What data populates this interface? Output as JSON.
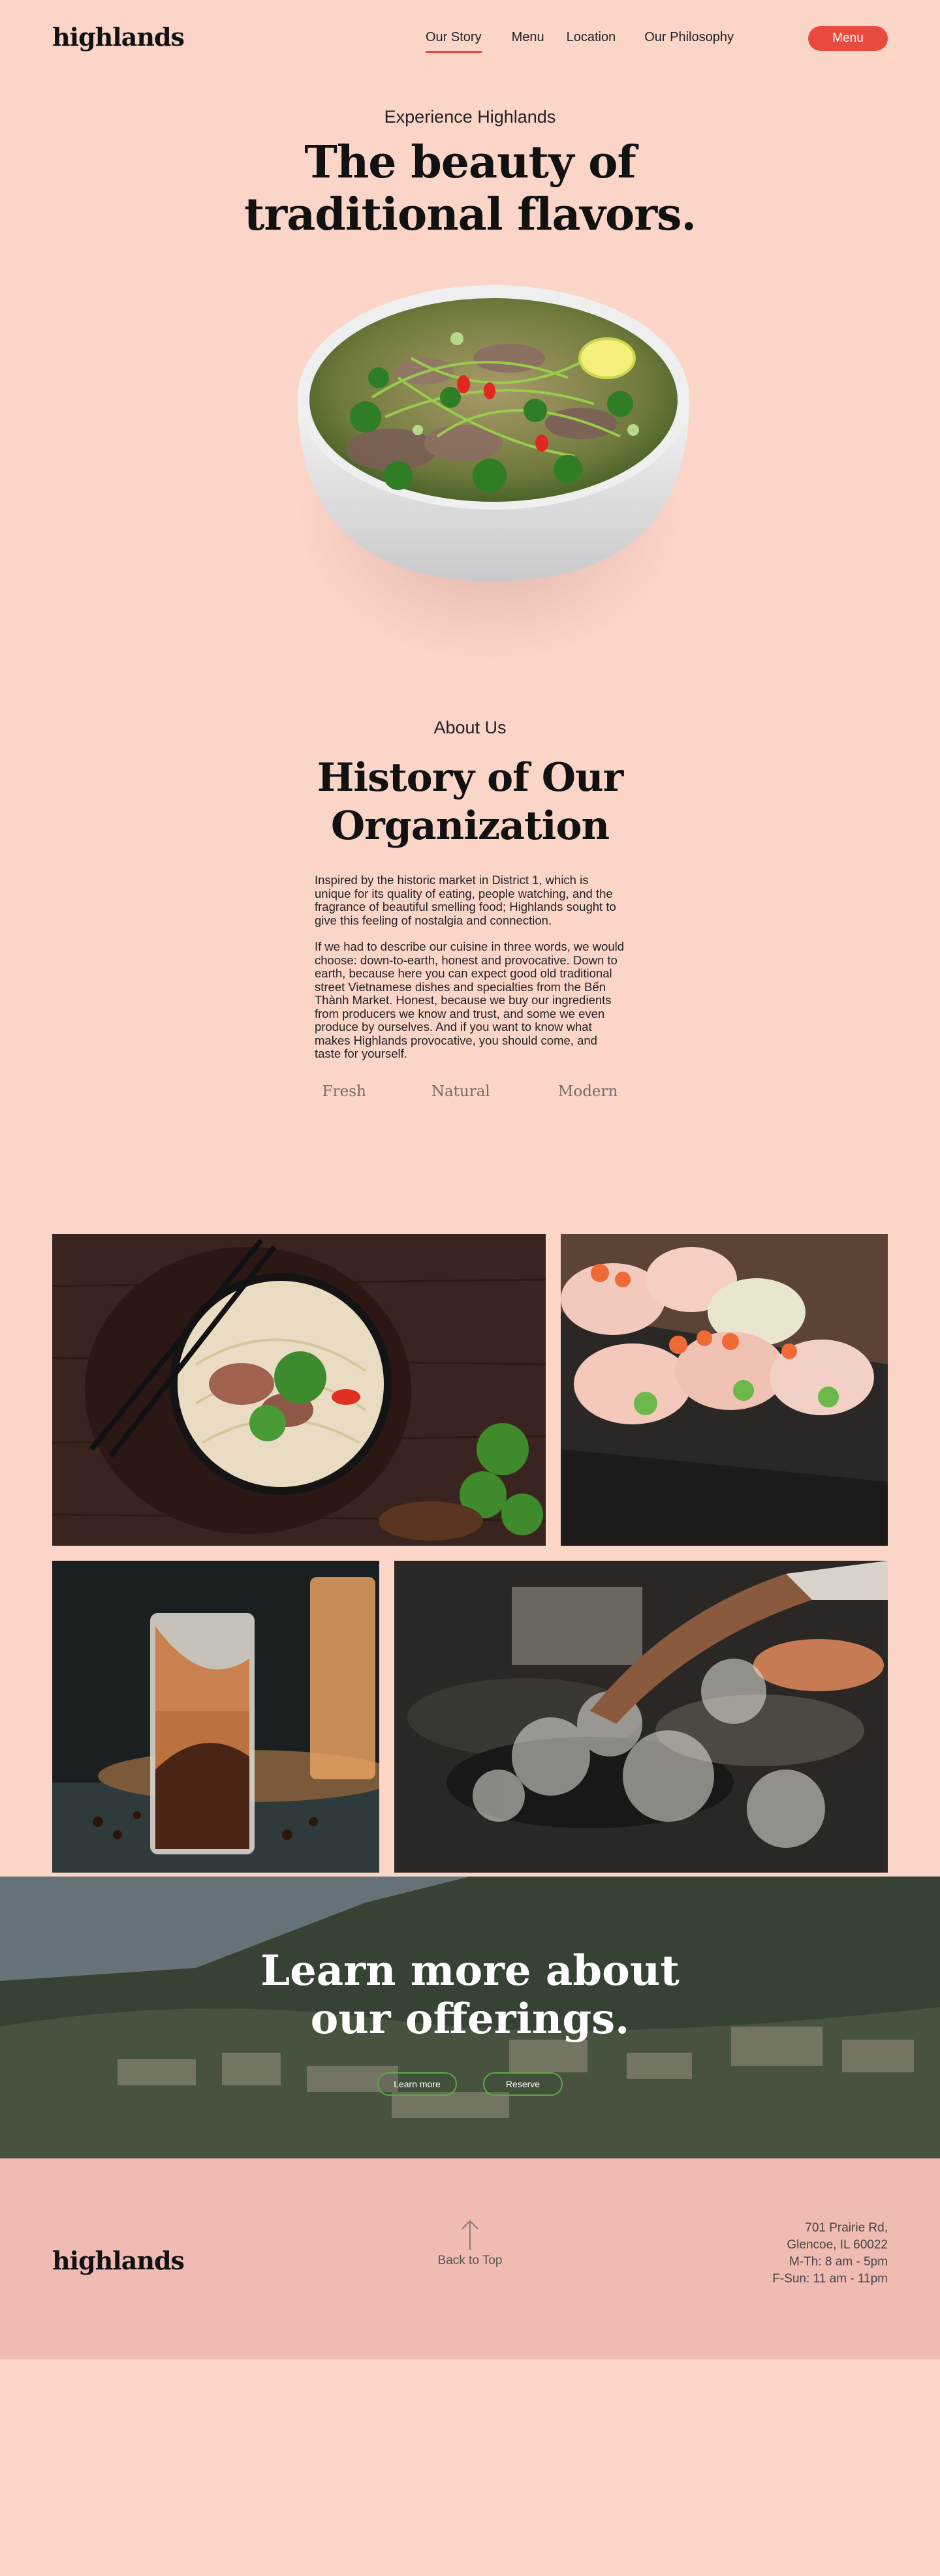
{
  "header": {
    "logo": "highlands",
    "nav": [
      "Our Story",
      "Menu",
      "Location",
      "Our Philosophy"
    ],
    "menu_button": "Menu"
  },
  "hero": {
    "eyebrow": "Experience Highlands",
    "title_line1": "The beauty of",
    "title_line2": "traditional flavors."
  },
  "about": {
    "eyebrow": "About Us",
    "title_line1": "History of Our",
    "title_line2": "Organization",
    "paragraph1": "Inspired by the historic market in District 1, which is unique for its quality of eating, people watching, and the fragrance of beautiful smelling food; Highlands sought to give this feeling of nostalgia and connection.",
    "paragraph2": "If we had to describe our cuisine in three words, we would choose: down-to-earth, honest and provocative. Down to earth, because here you can expect good old traditional street Vietnamese dishes and specialties from the Bến Thành Market. Honest, because we buy our ingredients from producers we know and trust, and some we even produce by ourselves. And if you want to know what makes Highlands provocative, you should come, and taste for yourself.",
    "pillars": [
      "Fresh",
      "Natural",
      "Modern"
    ]
  },
  "banner": {
    "title_line1": "Learn more about",
    "title_line2": "our offerings.",
    "learn_more": "Learn more",
    "reserve": "Reserve"
  },
  "footer": {
    "logo": "highlands",
    "back_to_top": "Back to Top",
    "address_line1": "701 Prairie Rd,",
    "address_line2": "Glencoe, IL 60022",
    "hours_line1": "M-Th: 8 am - 5pm",
    "hours_line2": "F-Sun: 11 am - 11pm"
  },
  "colors": {
    "background": "#fcd5c9",
    "accent": "#e94a3f",
    "footer_bg": "#efbbb2",
    "button_outline": "#5fa84a"
  }
}
